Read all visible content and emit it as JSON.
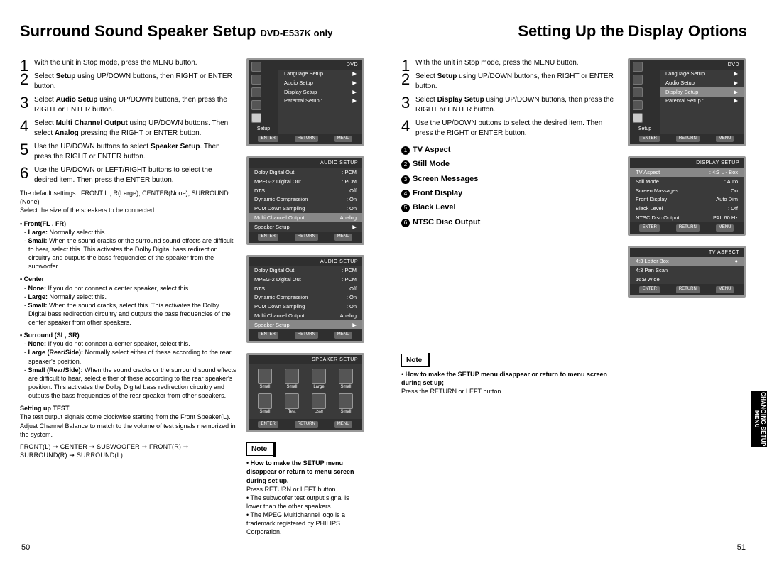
{
  "left": {
    "title": "Surround Sound Speaker Setup",
    "title_sub": "DVD-E537K only",
    "steps": [
      "With the unit in Stop mode, press the MENU button.",
      "Select <b>Setup</b> using UP/DOWN buttons, then RIGHT or ENTER button.",
      "Select <b>Audio Setup</b> using UP/DOWN buttons, then press the RIGHT or ENTER button.",
      "Select <b>Multi Channel Output</b> using UP/DOWN buttons. Then select <b>Analog</b> pressing the RIGHT or ENTER button.",
      "Use the UP/DOWN buttons to select <b>Speaker Setup</b>. Then press the RIGHT or ENTER button.",
      "Use the UP/DOWN or LEFT/RIGHT buttons to select the desired item. Then press the ENTER button."
    ],
    "defaults_line1": "The default settings : FRONT L , R(Large), CENTER(None), SURROUND (None)",
    "defaults_line2": "Select the size of the speakers to be connected.",
    "front_hd": "Front(FL , FR)",
    "front_items": [
      "- <b>Large:</b> Normally select this.",
      "- <b>Small:</b> When the sound cracks or the surround sound effects are difficult to hear, select this. This activates the Dolby Digital bass redirection circuitry and outputs the bass frequencies of the speaker from the subwoofer."
    ],
    "center_hd": "Center",
    "center_items": [
      "- <b>None:</b> If you do not connect a center speaker, select this.",
      "- <b>Large:</b> Normally select this.",
      "- <b>Small:</b> When the sound cracks, select this. This activates the Dolby Digital bass redirection circuitry and outputs the bass frequencies of the center speaker from other speakers."
    ],
    "surround_hd": "Surround (SL, SR)",
    "surround_items": [
      "- <b>None:</b> If you do not connect a center speaker, select this.",
      "- <b>Large (Rear/Side):</b> Normally select either of these according to the rear speaker's position.",
      "- <b>Small (Rear/Side):</b> When the sound cracks or the surround sound effects are difficult to hear, select either of these according to the rear speaker's position. This activates the Dolby Digital bass redirection circuitry and outputs the bass frequencies of the rear speaker from other speakers."
    ],
    "test_hd": "Setting up TEST",
    "test_body": "The test output signals come clockwise starting from the Front Speaker(L). Adjust Channel Balance to match to the volume of test signals memorized in the system.",
    "flow": "FRONT(L) ➞ CENTER ➞ SUBWOOFER ➞ FRONT(R) ➞ SURROUND(R) ➞ SURROUND(L)",
    "screens": {
      "s1_title": "DVD",
      "s1_rows": [
        [
          "Language Setup",
          "▶"
        ],
        [
          "Audio Setup",
          "▶"
        ],
        [
          "Display Setup",
          "▶"
        ],
        [
          "Parental Setup :",
          "▶"
        ]
      ],
      "s2_title": "AUDIO SETUP",
      "s2_rows": [
        [
          "Dolby Digital Out",
          ": PCM"
        ],
        [
          "MPEG-2 Digital Out",
          ": PCM"
        ],
        [
          "DTS",
          ": Off"
        ],
        [
          "Dynamic Compression",
          ": On"
        ],
        [
          "PCM Down Sampling",
          ": On"
        ],
        [
          "Multi Channel Output",
          ": Analog"
        ],
        [
          "Speaker Setup",
          "▶"
        ]
      ],
      "s2_hl": 5,
      "s3_title": "AUDIO SETUP",
      "s3_rows": [
        [
          "Dolby Digital Out",
          ": PCM"
        ],
        [
          "MPEG-2 Digital Out",
          ": PCM"
        ],
        [
          "DTS",
          ": Off"
        ],
        [
          "Dynamic Compression",
          ": On"
        ],
        [
          "PCM Down Sampling",
          ": On"
        ],
        [
          "Multi Channel Output",
          ": Analog"
        ],
        [
          "Speaker Setup",
          "▶"
        ]
      ],
      "s3_hl": 6,
      "s4_title": "SPEAKER SETUP",
      "s4_spk": [
        [
          "Small",
          "Small",
          "Large",
          "Small"
        ],
        [
          "Small",
          "Test",
          "User",
          "Small"
        ]
      ]
    },
    "note_label": "Note",
    "note_items": [
      "• <b>How to make the SETUP menu disappear or return to menu screen during set up.</b>",
      "Press RETURN or LEFT button.",
      "• The subwoofer test output signal is lower than the other speakers.",
      "• The MPEG Multichannel logo is a trademark registered by PHILIPS Corporation."
    ],
    "page_num": "50"
  },
  "right": {
    "title": "Setting Up the Display Options",
    "steps": [
      "With the unit in Stop mode, press the MENU button.",
      "Select <b>Setup</b> using UP/DOWN buttons, then RIGHT or ENTER button.",
      "Select <b>Display Setup</b> using UP/DOWN buttons, then press the RIGHT or ENTER button.",
      "Use the UP/DOWN buttons to select the desired item. Then press the RIGHT or ENTER button."
    ],
    "options": [
      "TV Aspect",
      "Still Mode",
      "Screen Messages",
      "Front Display",
      "Black Level",
      "NTSC Disc Output"
    ],
    "screens": {
      "s1_title": "DVD",
      "s1_rows": [
        [
          "Language Setup",
          "▶"
        ],
        [
          "Audio Setup",
          "▶"
        ],
        [
          "Display Setup",
          "▶"
        ],
        [
          "Parental Setup :",
          "▶"
        ]
      ],
      "s1_hl": 2,
      "s2_title": "DISPLAY SETUP",
      "s2_rows": [
        [
          "TV Aspect",
          ": 4:3 L - Box"
        ],
        [
          "Still Mode",
          ": Auto"
        ],
        [
          "Screen Massages",
          ": On"
        ],
        [
          "Front Display",
          ": Auto Dim"
        ],
        [
          "Black Level",
          ": Off"
        ],
        [
          "NTSC Disc Output",
          ": PAL 60 Hz"
        ]
      ],
      "s2_hl": 0,
      "s3_title": "TV ASPECT",
      "s3_rows": [
        [
          "4:3 Letter Box",
          "●"
        ],
        [
          "4:3 Pan Scan",
          ""
        ],
        [
          "16:9 Wide",
          ""
        ]
      ],
      "s3_hl": 0
    },
    "note_label": "Note",
    "note_items": [
      "• <b>How to make the SETUP menu disappear or return to menu screen during set up;</b>",
      "Press the RETURN or LEFT button."
    ],
    "side_tab": "CHANGING SETUP MENU",
    "page_num": "51"
  },
  "screen_buttons": [
    "ENTER",
    "RETURN",
    "MENU"
  ]
}
